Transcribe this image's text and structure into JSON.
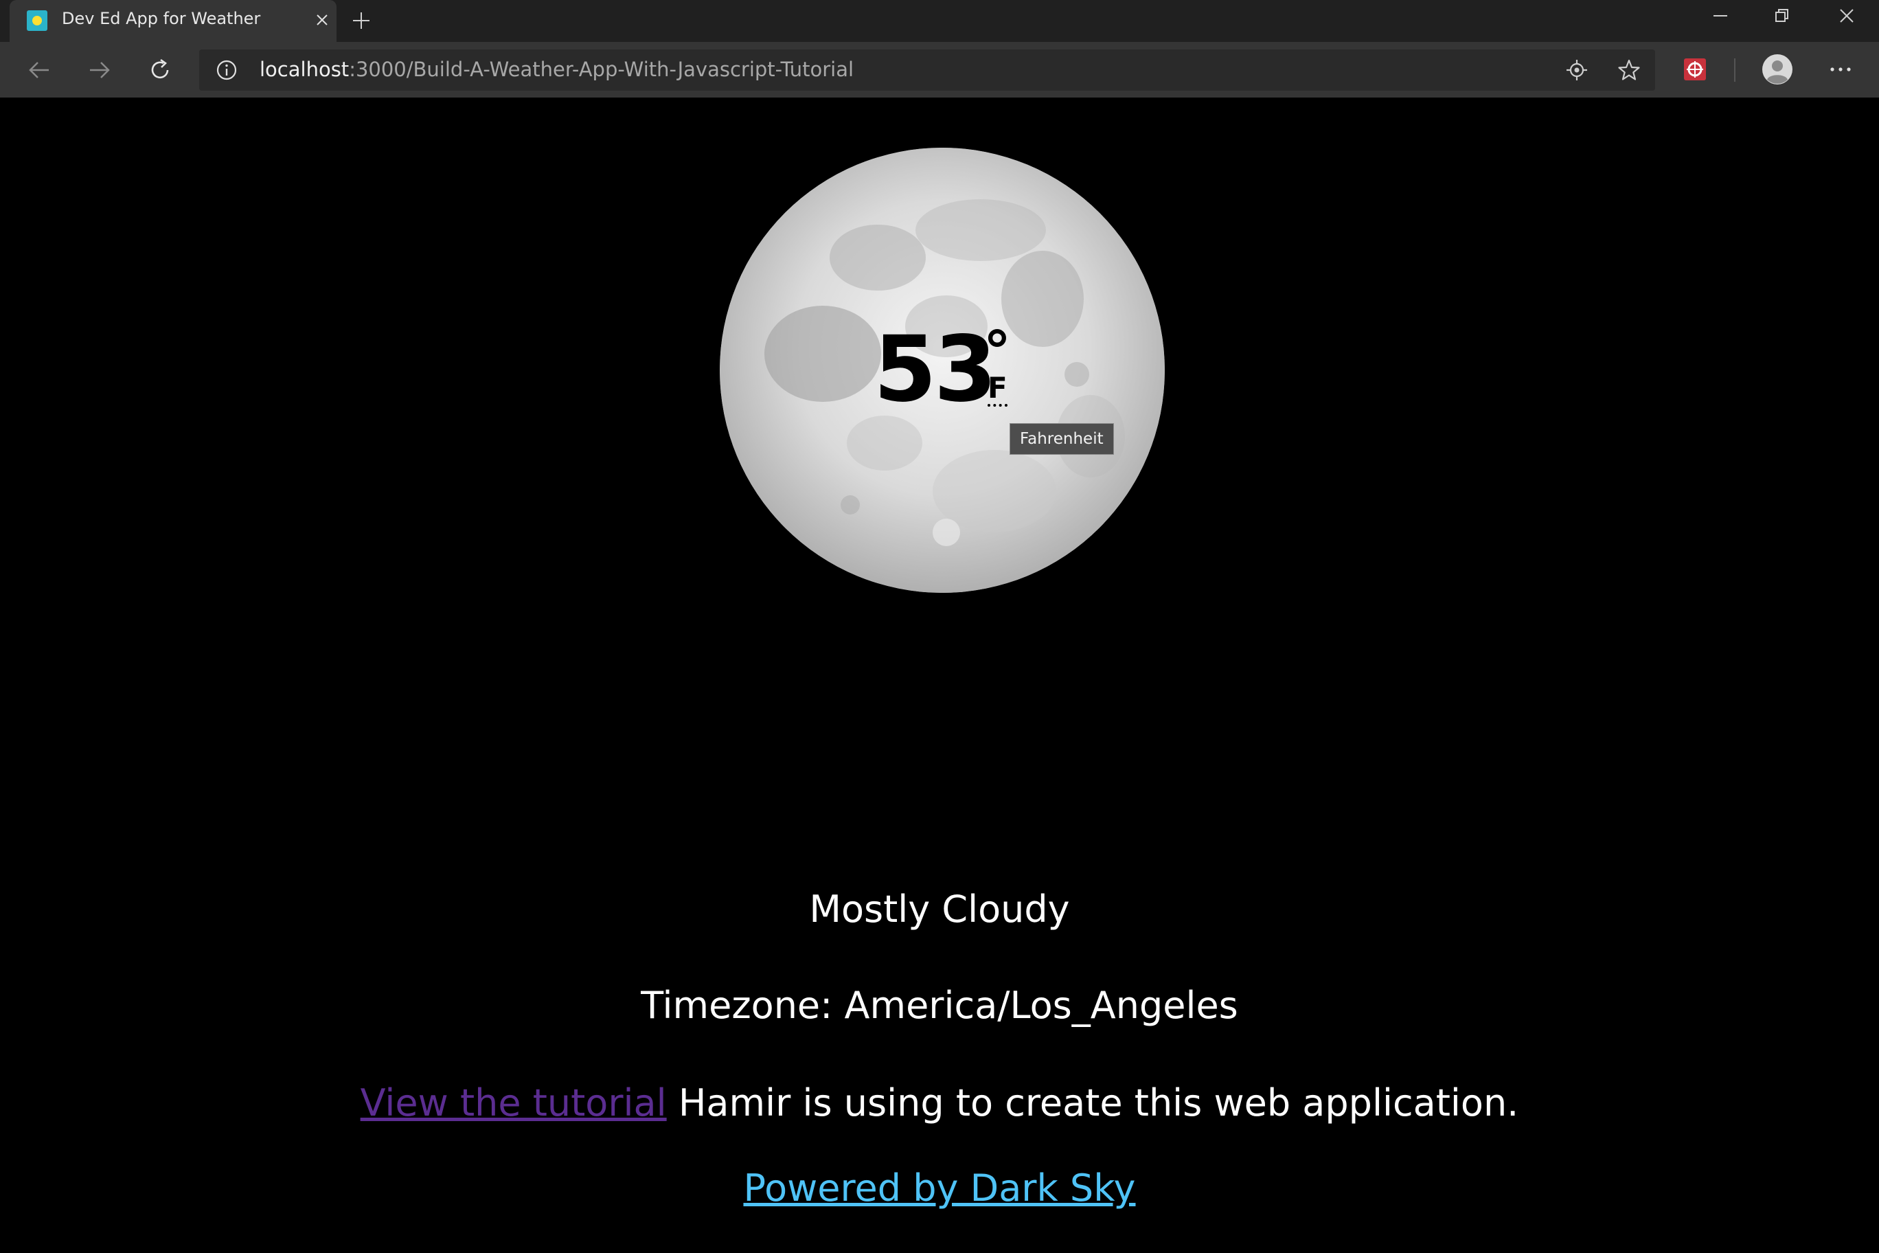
{
  "browser": {
    "tab": {
      "title": "Dev Ed App for Weather",
      "favicon": "sun-favicon-icon"
    },
    "url": {
      "host": "localhost",
      "path": ":3000/Build-A-Weather-App-With-Javascript-Tutorial"
    },
    "icons": {
      "back": "back-arrow-icon",
      "forward": "forward-arrow-icon",
      "refresh": "refresh-icon",
      "site_info": "info-icon",
      "location": "location-icon",
      "favorite": "star-icon",
      "extension": "extension-icon",
      "profile": "profile-icon",
      "menu": "more-icon"
    }
  },
  "weather": {
    "temperature": "53",
    "degree_symbol": "°",
    "unit": "F",
    "unit_tooltip": "Fahrenheit",
    "summary": "Mostly Cloudy",
    "timezone_label": "Timezone:",
    "timezone": "America/Los_Angeles",
    "tutorial_link_text": "View the tutorial",
    "tutorial_suffix": "Hamir is using to create this web application.",
    "powered_by_text": "Powered by Dark Sky"
  },
  "colors": {
    "page_background": "#000000",
    "text": "#ffffff",
    "tutorial_link": "#5b2d91",
    "powered_link": "#4fc3f7"
  }
}
